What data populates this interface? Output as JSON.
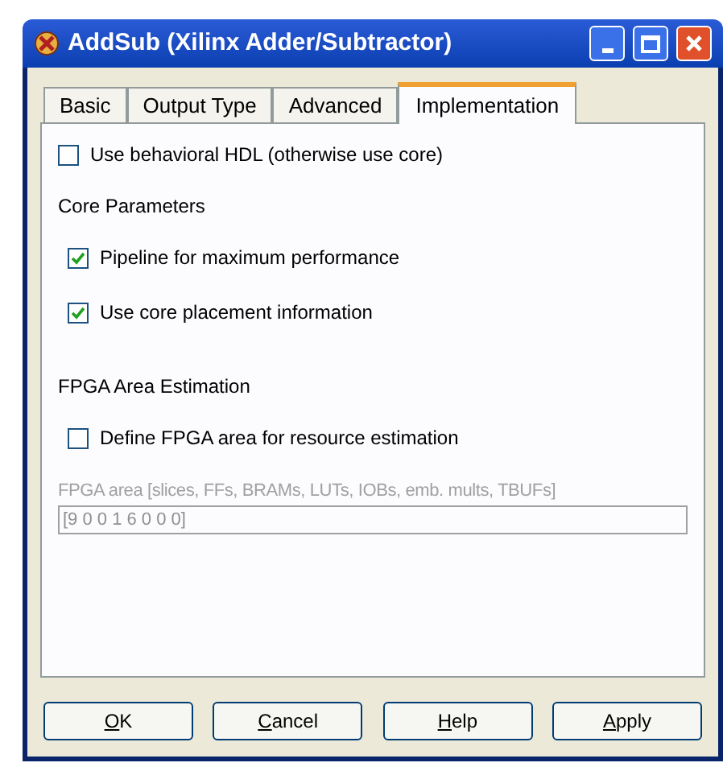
{
  "window": {
    "title": "AddSub (Xilinx Adder/Subtractor)"
  },
  "tabs": [
    {
      "label": "Basic",
      "selected": false
    },
    {
      "label": "Output Type",
      "selected": false
    },
    {
      "label": "Advanced",
      "selected": false
    },
    {
      "label": "Implementation",
      "selected": true
    }
  ],
  "options": [
    {
      "kind": "checkbox",
      "label": "Use behavioral HDL (otherwise use core)",
      "checked": false
    },
    {
      "kind": "heading",
      "label": "Core Parameters"
    },
    {
      "kind": "checkbox",
      "label": "Pipeline for maximum performance",
      "checked": true,
      "indent": true
    },
    {
      "kind": "checkbox",
      "label": "Use core placement information",
      "checked": true,
      "indent": true
    },
    {
      "kind": "heading",
      "label": "FPGA Area Estimation"
    },
    {
      "kind": "checkbox",
      "label": "Define FPGA area for resource estimation",
      "checked": false,
      "indent": true
    },
    {
      "kind": "field",
      "label": "FPGA area [slices, FFs, BRAMs, LUTs, IOBs, emb. mults, TBUFs]",
      "value": "[9 0 0 1 6 0 0 0]",
      "disabled": true
    }
  ],
  "buttons": [
    "OK",
    "Cancel",
    "Help",
    "Apply"
  ]
}
